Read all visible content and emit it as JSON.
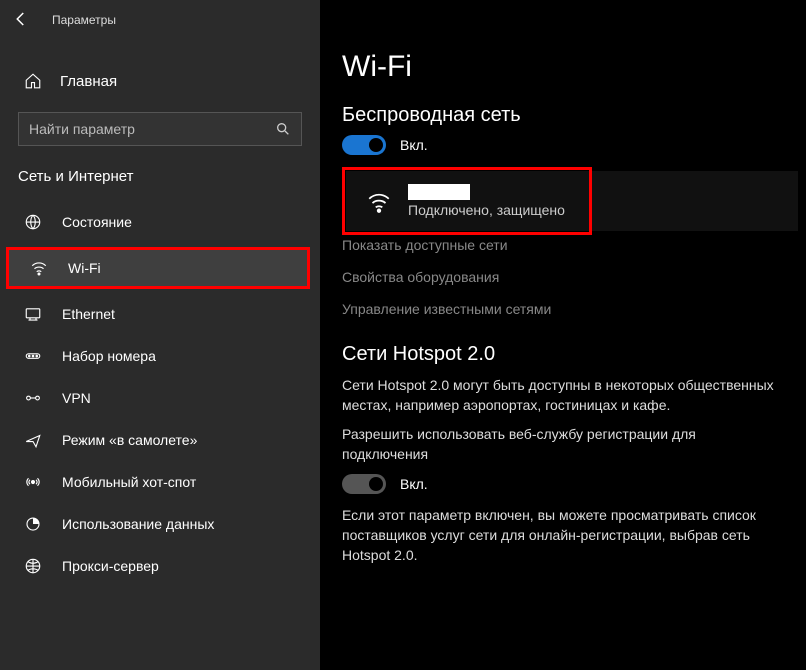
{
  "window": {
    "title": "Параметры"
  },
  "sidebar": {
    "home_label": "Главная",
    "search_placeholder": "Найти параметр",
    "section_title": "Сеть и Интернет",
    "items": [
      {
        "label": "Состояние"
      },
      {
        "label": "Wi-Fi"
      },
      {
        "label": "Ethernet"
      },
      {
        "label": "Набор номера"
      },
      {
        "label": "VPN"
      },
      {
        "label": "Режим «в самолете»"
      },
      {
        "label": "Мобильный хот-спот"
      },
      {
        "label": "Использование данных"
      },
      {
        "label": "Прокси-сервер"
      }
    ]
  },
  "main": {
    "title": "Wi-Fi",
    "wireless_heading": "Беспроводная сеть",
    "toggle1_label": "Вкл.",
    "network": {
      "status": "Подключено, защищено"
    },
    "show_networks": "Показать доступные сети",
    "hardware_props": "Свойства оборудования",
    "manage_known": "Управление известными сетями",
    "hotspot": {
      "heading": "Сети Hotspot 2.0",
      "desc1": "Сети Hotspot 2.0 могут быть доступны в некоторых общественных местах, например аэропортах, гостиницах и кафе.",
      "desc2": "Разрешить использовать веб-службу регистрации для подключения",
      "toggle_label": "Вкл.",
      "desc3": "Если этот параметр включен, вы можете просматривать список поставщиков услуг сети для онлайн-регистрации, выбрав сеть Hotspot 2.0."
    }
  }
}
